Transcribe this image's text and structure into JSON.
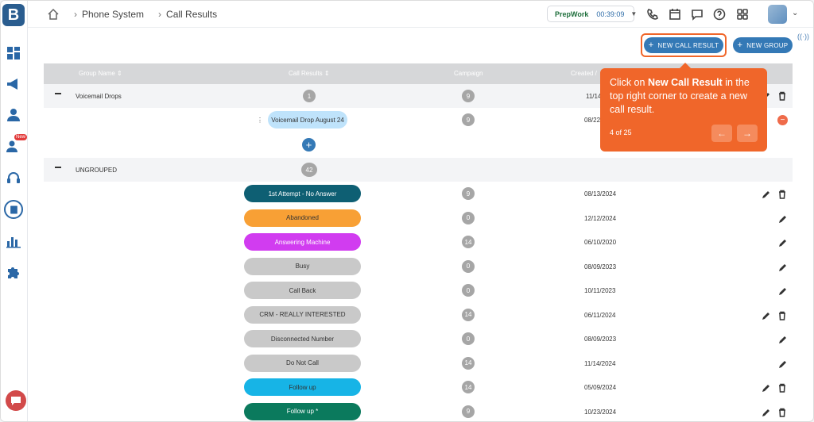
{
  "app": {
    "logo_letter": "B"
  },
  "sidebar": {
    "new_badge": "New"
  },
  "breadcrumb": {
    "items": [
      "Phone System",
      "Call Results"
    ]
  },
  "status": {
    "name": "PrepWork",
    "time": "00:39:09",
    "color": "#22c55e"
  },
  "buttons": {
    "new_call_result": "NEW CALL RESULT",
    "new_group": "NEW GROUP"
  },
  "table": {
    "headers": {
      "group_name": "Group Name",
      "call_results": "Call Results",
      "campaign": "Campaign",
      "created": "Created / "
    },
    "groups": [
      {
        "name": "Voicemail Drops",
        "count": "1",
        "campaign": "9",
        "date": "11/14/"
      },
      {
        "name": "UNGROUPED",
        "count": "42"
      }
    ],
    "voicemail_row": {
      "label": "Voicemail Drop August 24",
      "campaign": "9",
      "date": "08/22",
      "color": "#bfe3fb"
    },
    "rows": [
      {
        "label": "1st Attempt - No Answer",
        "campaign": "9",
        "date": "08/13/2024",
        "color": "#0e5f73",
        "text_color": "#ffffff"
      },
      {
        "label": "Abandoned",
        "campaign": "0",
        "date": "12/12/2024",
        "color": "#f8a035",
        "text_color": "#333333"
      },
      {
        "label": "Answering Machine",
        "campaign": "14",
        "date": "06/10/2020",
        "color": "#d13cf0",
        "text_color": "#ffffff"
      },
      {
        "label": "Busy",
        "campaign": "0",
        "date": "08/09/2023",
        "color": "#c9c9c9",
        "text_color": "#333333"
      },
      {
        "label": "Call Back",
        "campaign": "0",
        "date": "10/11/2023",
        "color": "#c9c9c9",
        "text_color": "#333333"
      },
      {
        "label": "CRM - REALLY INTERESTED",
        "campaign": "14",
        "date": "06/11/2024",
        "color": "#c9c9c9",
        "text_color": "#333333"
      },
      {
        "label": "Disconnected Number",
        "campaign": "0",
        "date": "08/09/2023",
        "color": "#c9c9c9",
        "text_color": "#333333"
      },
      {
        "label": "Do Not Call",
        "campaign": "14",
        "date": "11/14/2024",
        "color": "#c9c9c9",
        "text_color": "#333333"
      },
      {
        "label": "Follow up",
        "campaign": "14",
        "date": "05/09/2024",
        "color": "#17b4e6",
        "text_color": "#333333"
      },
      {
        "label": "Follow up *",
        "campaign": "9",
        "date": "10/23/2024",
        "color": "#0b7a5d",
        "text_color": "#ffffff"
      }
    ]
  },
  "tooltip": {
    "pre": "Click on ",
    "bold": "New Call Result",
    "post": " in the top right corner to create a new call result.",
    "step": "4 of 25",
    "prev": "←",
    "next": "→"
  }
}
